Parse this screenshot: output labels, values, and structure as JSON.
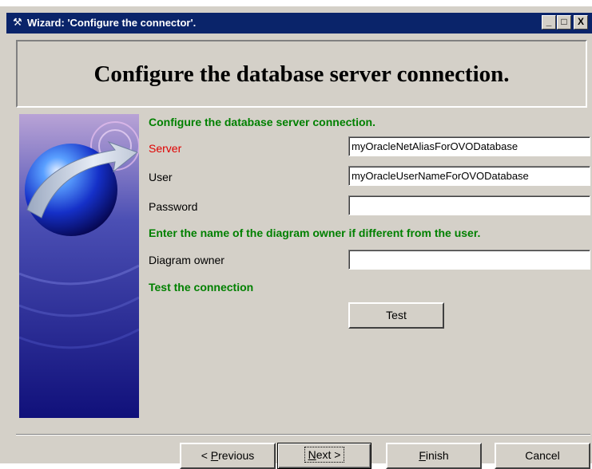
{
  "window": {
    "title": "Wizard: 'Configure the connector'.",
    "minimize_label": "_",
    "maximize_label": "□",
    "close_label": "X"
  },
  "header": {
    "title": "Configure the database server connection."
  },
  "form": {
    "section_title": "Configure the database server connection.",
    "server_label": "Server",
    "server_value": "myOracleNetAliasForOVODatabase",
    "user_label": "User",
    "user_value": "myOracleUserNameForOVODatabase",
    "password_label": "Password",
    "password_value": "",
    "owner_note": "Enter the name of the diagram owner if different from the user.",
    "owner_label": "Diagram owner",
    "owner_value": "",
    "test_title": "Test the connection",
    "test_button": "Test"
  },
  "footer": {
    "previous_prefix": "< ",
    "previous_hotkey": "P",
    "previous_rest": "revious",
    "next_hotkey": "N",
    "next_rest": "ext >",
    "finish_hotkey": "F",
    "finish_rest": "inish",
    "cancel": "Cancel"
  },
  "colors": {
    "title_bar": "#0a246a",
    "section_green": "#008000",
    "required_red": "#e00000",
    "dialog_face": "#d4d0c8"
  },
  "icons": {
    "window_icon": "wand-icon"
  }
}
